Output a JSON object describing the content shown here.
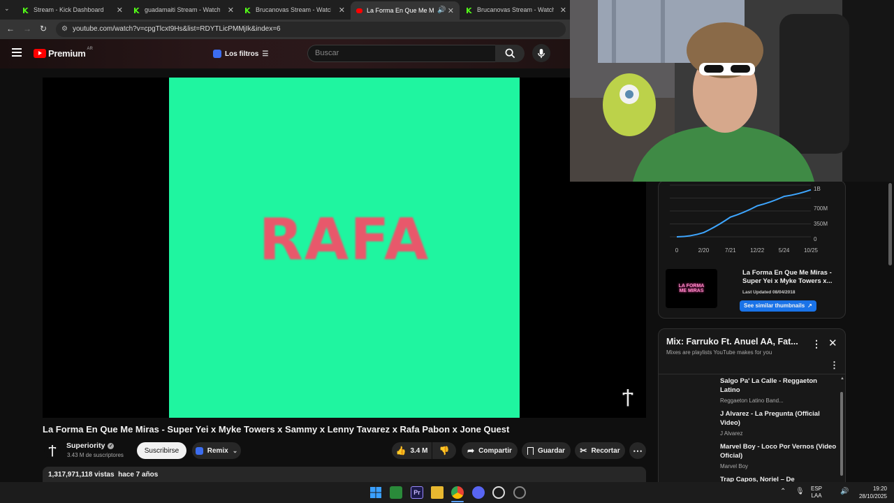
{
  "browser": {
    "tabs": [
      {
        "title": "Stream - Kick Dashboard",
        "favicon": "kick-icon"
      },
      {
        "title": "guadamaiti Stream - Watch Live",
        "favicon": "kick-icon"
      },
      {
        "title": "Brucanovas Stream - Watch Live",
        "favicon": "kick-icon"
      },
      {
        "title": "La Forma En Que Me Miras",
        "favicon": "youtube-icon",
        "active": true
      },
      {
        "title": "Brucanovas Stream - Watch Live",
        "favicon": "kick-icon"
      }
    ],
    "url": "youtube.com/watch?v=cpgTlcxt9Hs&list=RDYTLicPMMjIk&index=6"
  },
  "youtube": {
    "logo_text": "Premium",
    "country": "AR",
    "filter_label": "Los filtros",
    "search_placeholder": "Buscar"
  },
  "video": {
    "frame_text": "RAFA",
    "title": "La Forma En Que Me Miras - Super Yei x Myke Towers x Sammy x Lenny Tavarez x Rafa Pabon x Jone Quest",
    "channel": "Superiority",
    "subscribers": "3.43 M de suscriptores",
    "subscribe_label": "Suscribirse",
    "remix_label": "Remix",
    "likes": "3.4 M",
    "share_label": "Compartir",
    "save_label": "Guardar",
    "clip_label": "Recortar",
    "views": "1,317,971,118 vistas",
    "age": "hace 7 años"
  },
  "stats_card": {
    "y_ticks": [
      "1B",
      "700M",
      "350M",
      "0"
    ],
    "x_ticks": [
      "0",
      "2/20",
      "7/21",
      "12/22",
      "5/24",
      "10/25"
    ],
    "thumb_text": "LA FORMA\nME MIRAS",
    "video_title": "La Forma En Que Me Miras - Super Yei x Myke Towers x...",
    "last_updated": "Last Updated 08/04/2018",
    "similar_label": "See similar thumbnails",
    "chart_data": {
      "type": "line",
      "x": [
        "0",
        "2/20",
        "7/21",
        "12/22",
        "5/24",
        "10/25"
      ],
      "y": [
        0,
        90,
        420,
        660,
        860,
        1000
      ],
      "ylim": [
        0,
        1100
      ]
    }
  },
  "mix": {
    "title": "Mix: Farruko Ft. Anuel AA, Fat...",
    "subtitle": "Mixes are playlists YouTube makes for you",
    "items": [
      {
        "title": "Salgo Pa' La Calle - Reggaeton Latino",
        "artist": "Reggaeton Latino Band..."
      },
      {
        "title": "J Alvarez - La Pregunta (Official Video)",
        "artist": "J Alvarez"
      },
      {
        "title": "Marvel Boy - Loco Por Vernos (Video Oficial)",
        "artist": "Marvel Boy"
      },
      {
        "title": "Trap Capos, Noriel – De",
        "artist": ""
      }
    ]
  },
  "taskbar": {
    "lang": "ESP",
    "lang2": "LAA",
    "time": "19:20",
    "date": "28/10/2025"
  },
  "colors": {
    "kick_green": "#53fc18",
    "yt_red": "#ff0000",
    "frame_green": "#1ff5a0",
    "rafa_pink": "#e8586b",
    "chart_blue": "#3ea6ff"
  }
}
